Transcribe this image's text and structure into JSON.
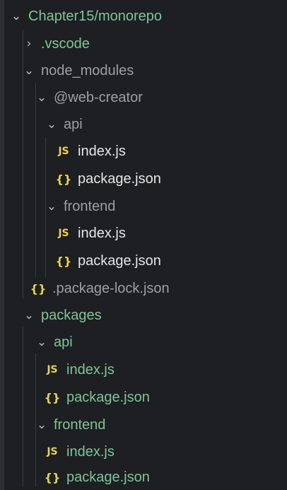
{
  "explorer": {
    "root": {
      "folder": "Chapter15",
      "separator": "/",
      "sub": "monorepo"
    },
    "items": [
      {
        "label": ".vscode",
        "type": "folder",
        "expanded": false
      },
      {
        "label": "node_modules",
        "type": "folder",
        "expanded": true
      },
      {
        "label": "@web-creator",
        "type": "folder",
        "expanded": true
      },
      {
        "label": "api",
        "type": "folder",
        "expanded": true
      },
      {
        "label": "index.js",
        "type": "js",
        "icon": "JS"
      },
      {
        "label": "package.json",
        "type": "json",
        "icon": "{}"
      },
      {
        "label": "frontend",
        "type": "folder",
        "expanded": true
      },
      {
        "label": "index.js",
        "type": "js",
        "icon": "JS"
      },
      {
        "label": "package.json",
        "type": "json",
        "icon": "{}"
      },
      {
        "label": ".package-lock.json",
        "type": "json",
        "icon": "{}"
      },
      {
        "label": "packages",
        "type": "folder",
        "expanded": true
      },
      {
        "label": "api",
        "type": "folder",
        "expanded": true
      },
      {
        "label": "index.js",
        "type": "js",
        "icon": "JS"
      },
      {
        "label": "package.json",
        "type": "json",
        "icon": "{}"
      },
      {
        "label": "frontend",
        "type": "folder",
        "expanded": true
      },
      {
        "label": "index.js",
        "type": "js",
        "icon": "JS"
      },
      {
        "label": "package.json",
        "type": "json",
        "icon": "{}"
      }
    ],
    "colors": {
      "background": "#1e1f22",
      "folder_green": "#7ec699",
      "ignored_gray": "#9aa0a6",
      "file_white": "#e6e6e6",
      "icon_yellow": "#e8d44d"
    }
  }
}
